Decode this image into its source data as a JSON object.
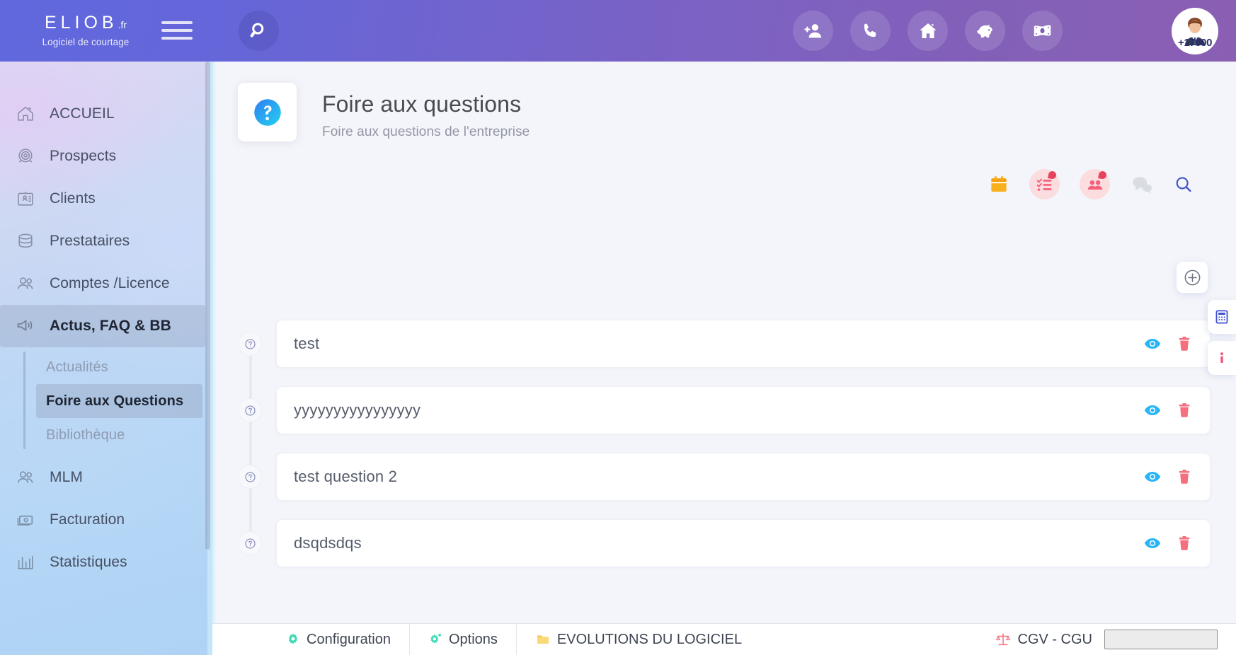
{
  "brand": {
    "name": "ELIOB",
    "tld": ".fr",
    "subtitle": "Logiciel de courtage"
  },
  "topbar": {
    "search_label": "Rechercher",
    "actions": [
      {
        "name": "add-user-icon",
        "label": "Ajouter un contact"
      },
      {
        "name": "phone-icon",
        "label": "Téléphone"
      },
      {
        "name": "home-icon",
        "label": "Accueil"
      },
      {
        "name": "piggy-bank-icon",
        "label": "Épargne"
      },
      {
        "name": "banknote-icon",
        "label": "Finances"
      }
    ],
    "avatar_badge": "+17000"
  },
  "sidebar": {
    "items": [
      {
        "label": "ACCUEIL",
        "icon": "home-icon",
        "active": false
      },
      {
        "label": "Prospects",
        "icon": "target-icon",
        "active": false
      },
      {
        "label": "Clients",
        "icon": "id-card-icon",
        "active": false
      },
      {
        "label": "Prestataires",
        "icon": "database-icon",
        "active": false
      },
      {
        "label": "Comptes /Licence",
        "icon": "users-icon",
        "active": false
      },
      {
        "label": "Actus, FAQ & BB",
        "icon": "megaphone-icon",
        "active": true
      },
      {
        "label": "MLM",
        "icon": "users-icon",
        "active": false
      },
      {
        "label": "Facturation",
        "icon": "banknote-icon",
        "active": false
      },
      {
        "label": "Statistiques",
        "icon": "bar-chart-icon",
        "active": false
      }
    ],
    "subitems": [
      {
        "label": "Actualités",
        "active": false
      },
      {
        "label": "Foire aux Questions",
        "active": true
      },
      {
        "label": "Bibliothèque",
        "active": false
      }
    ]
  },
  "page": {
    "title": "Foire aux questions",
    "subtitle": "Foire aux questions de l'entreprise",
    "icon": "question-circle-icon",
    "header_actions": [
      {
        "name": "calendar-icon",
        "label": "Agenda"
      },
      {
        "name": "task-list-icon",
        "label": "Tâches"
      },
      {
        "name": "contacts-icon",
        "label": "Contacts"
      },
      {
        "name": "chat-icon",
        "label": "Messagerie"
      },
      {
        "name": "search-icon",
        "label": "Recherche"
      }
    ],
    "add_button_label": "Ajouter une question"
  },
  "questions": [
    {
      "text": "test",
      "view_label": "Voir",
      "delete_label": "Supprimer"
    },
    {
      "text": "yyyyyyyyyyyyyyyy",
      "view_label": "Voir",
      "delete_label": "Supprimer"
    },
    {
      "text": "test question 2",
      "view_label": "Voir",
      "delete_label": "Supprimer"
    },
    {
      "text": "dsqdsdqs",
      "view_label": "Voir",
      "delete_label": "Supprimer"
    }
  ],
  "side_tabs": [
    {
      "name": "calculator-icon",
      "label": "Calculatrice"
    },
    {
      "name": "info-icon",
      "label": "Informations"
    }
  ],
  "bottombar": {
    "items": [
      {
        "label": "Configuration",
        "icon": "gear-icon"
      },
      {
        "label": "Options",
        "icon": "gear-options-icon"
      },
      {
        "label": "EVOLUTIONS DU LOGICIEL",
        "icon": "folder-icon"
      },
      {
        "label": "CGV - CGU",
        "icon": "scales-icon"
      }
    ]
  },
  "colors": {
    "topbar_start": "#5f68dd",
    "topbar_end": "#8a5fb3",
    "accent_blue": "#29b6f6",
    "accent_pink": "#f4707f",
    "accent_teal": "#3ddbb4",
    "accent_orange": "#f9b01e",
    "indigo": "#3f51d5"
  }
}
